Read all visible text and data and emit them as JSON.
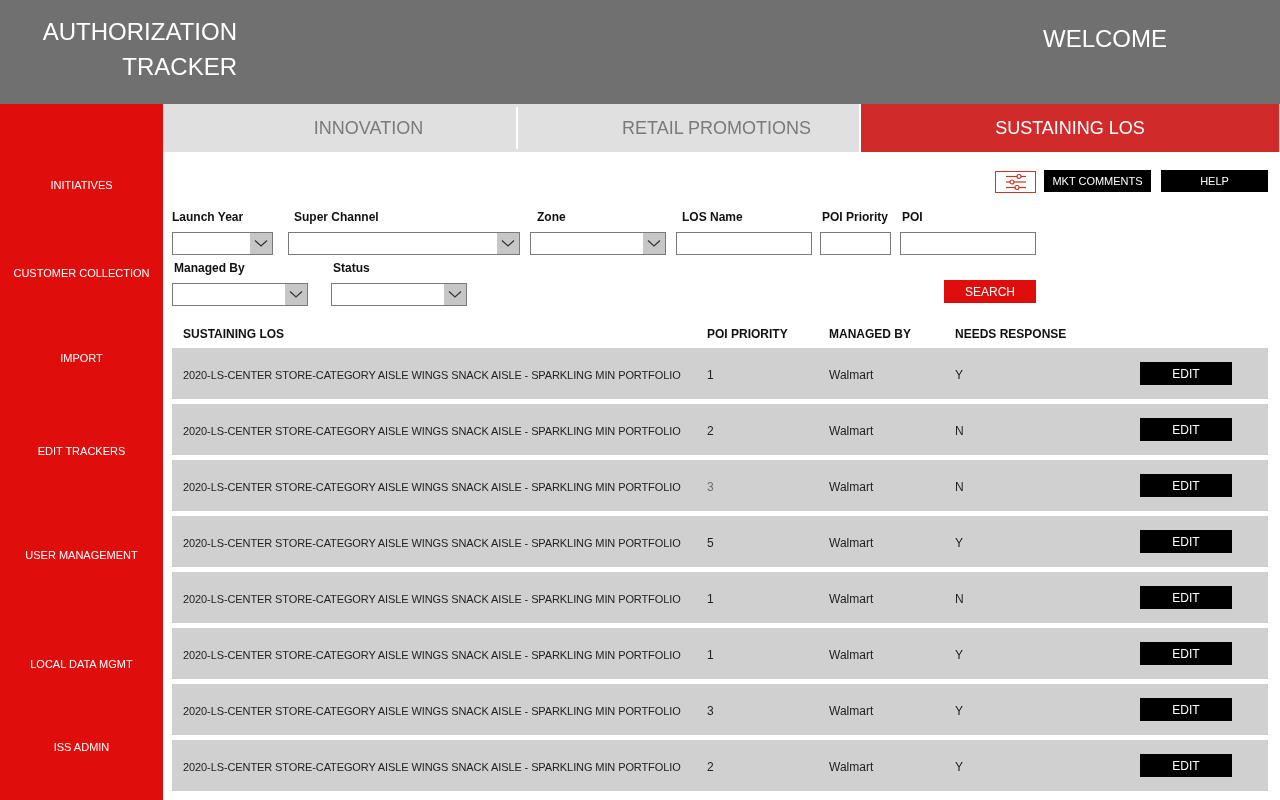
{
  "header": {
    "title_lines": [
      "AUTHORIZATION",
      "TRACKER"
    ],
    "welcome": "WELCOME"
  },
  "sidebar": {
    "items": [
      {
        "label": "INITIATIVES"
      },
      {
        "label": "CUSTOMER COLLECTION"
      },
      {
        "label": "IMPORT"
      },
      {
        "label": "EDIT TRACKERS"
      },
      {
        "label": "USER MANAGEMENT"
      },
      {
        "label": "LOCAL DATA MGMT"
      },
      {
        "label": "ISS ADMIN"
      }
    ]
  },
  "tabs": [
    {
      "label": "INNOVATION",
      "selected": false
    },
    {
      "label": "RETAIL PROMOTIONS",
      "selected": false
    },
    {
      "label": "SUSTAINING LOS",
      "selected": true
    }
  ],
  "toolbar": [
    {
      "kind": "filter"
    },
    {
      "kind": "text",
      "label": "MKT COMMENTS"
    },
    {
      "kind": "text",
      "label": "HELP"
    }
  ],
  "filters": {
    "rows": [
      [
        {
          "kind": "dropdown",
          "label": "Launch Year"
        },
        {
          "kind": "dropdown",
          "label": "Super Channel"
        },
        {
          "kind": "dropdown",
          "label": "Zone"
        },
        {
          "kind": "text",
          "label": "LOS Name"
        },
        {
          "kind": "text",
          "label": "POI Priority"
        },
        {
          "kind": "text",
          "label": "POI"
        }
      ],
      [
        {
          "kind": "dropdown",
          "label": "Managed By"
        },
        {
          "kind": "dropdown",
          "label": "Status"
        }
      ]
    ],
    "search_button": "SEARCH"
  },
  "table": {
    "columns": [
      "SUSTAINING LOS",
      "POI PRIORITY",
      "MANAGED BY",
      "NEEDS RESPONSE"
    ],
    "rows": [
      {
        "sustaining_los": "2020-LS-CENTER STORE-CATEGORY AISLE WINGS SNACK AISLE - SPARKLING MIN PORTFOLIO",
        "poi_priority": "1",
        "poi_priority_greyed": false,
        "managed_by": "Walmart",
        "needs_response": "Y",
        "action": "EDIT"
      },
      {
        "sustaining_los": "2020-LS-CENTER STORE-CATEGORY AISLE WINGS SNACK AISLE - SPARKLING MIN PORTFOLIO",
        "poi_priority": "2",
        "poi_priority_greyed": false,
        "managed_by": "Walmart",
        "needs_response": "N",
        "action": "EDIT"
      },
      {
        "sustaining_los": "2020-LS-CENTER STORE-CATEGORY AISLE WINGS SNACK AISLE - SPARKLING MIN PORTFOLIO",
        "poi_priority": "3",
        "poi_priority_greyed": true,
        "managed_by": "Walmart",
        "needs_response": "N",
        "action": "EDIT"
      },
      {
        "sustaining_los": "2020-LS-CENTER STORE-CATEGORY AISLE WINGS SNACK AISLE - SPARKLING MIN PORTFOLIO",
        "poi_priority": "5",
        "poi_priority_greyed": false,
        "managed_by": "Walmart",
        "needs_response": "Y",
        "action": "EDIT"
      },
      {
        "sustaining_los": "2020-LS-CENTER STORE-CATEGORY AISLE WINGS SNACK AISLE - SPARKLING MIN PORTFOLIO",
        "poi_priority": "1",
        "poi_priority_greyed": false,
        "managed_by": "Walmart",
        "needs_response": "N",
        "action": "EDIT"
      },
      {
        "sustaining_los": "2020-LS-CENTER STORE-CATEGORY AISLE WINGS SNACK AISLE - SPARKLING MIN PORTFOLIO",
        "poi_priority": "1",
        "poi_priority_greyed": false,
        "managed_by": "Walmart",
        "needs_response": "Y",
        "action": "EDIT"
      },
      {
        "sustaining_los": "2020-LS-CENTER STORE-CATEGORY AISLE WINGS SNACK AISLE - SPARKLING MIN PORTFOLIO",
        "poi_priority": "3",
        "poi_priority_greyed": false,
        "managed_by": "Walmart",
        "needs_response": "Y",
        "action": "EDIT"
      },
      {
        "sustaining_los": "2020-LS-CENTER STORE-CATEGORY AISLE WINGS SNACK AISLE - SPARKLING MIN PORTFOLIO",
        "poi_priority": "2",
        "poi_priority_greyed": false,
        "managed_by": "Walmart",
        "needs_response": "Y",
        "action": "EDIT"
      }
    ]
  }
}
